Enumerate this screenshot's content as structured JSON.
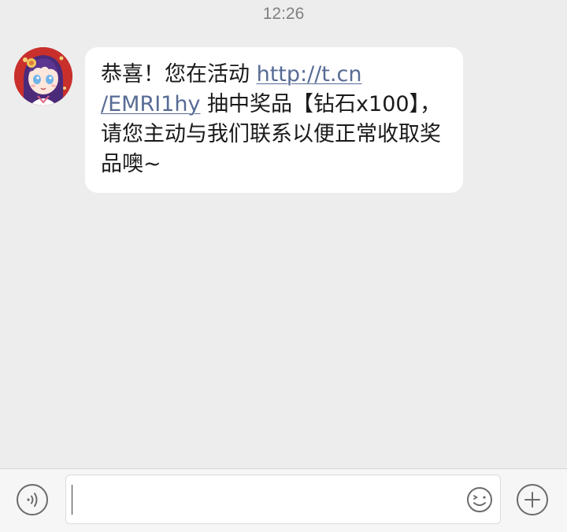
{
  "timestamp": "12:26",
  "message": {
    "text_before": "恭喜！您在活动 ",
    "link_line1": "http://t.cn",
    "link_line2": "/EMRI1hy",
    "text_after": " 抽中奖品【钻石x100】，请您主动与我们联系以便正常收取奖品噢~",
    "link_color": "#576b95",
    "bubble_color": "#ffffff"
  },
  "input_bar": {
    "text_value": "",
    "voice_icon": "voice-icon",
    "emoji_icon": "emoji-icon",
    "plus_icon": "plus-icon"
  },
  "colors": {
    "background": "#ededed",
    "avatar_bg": "#c9302c"
  }
}
